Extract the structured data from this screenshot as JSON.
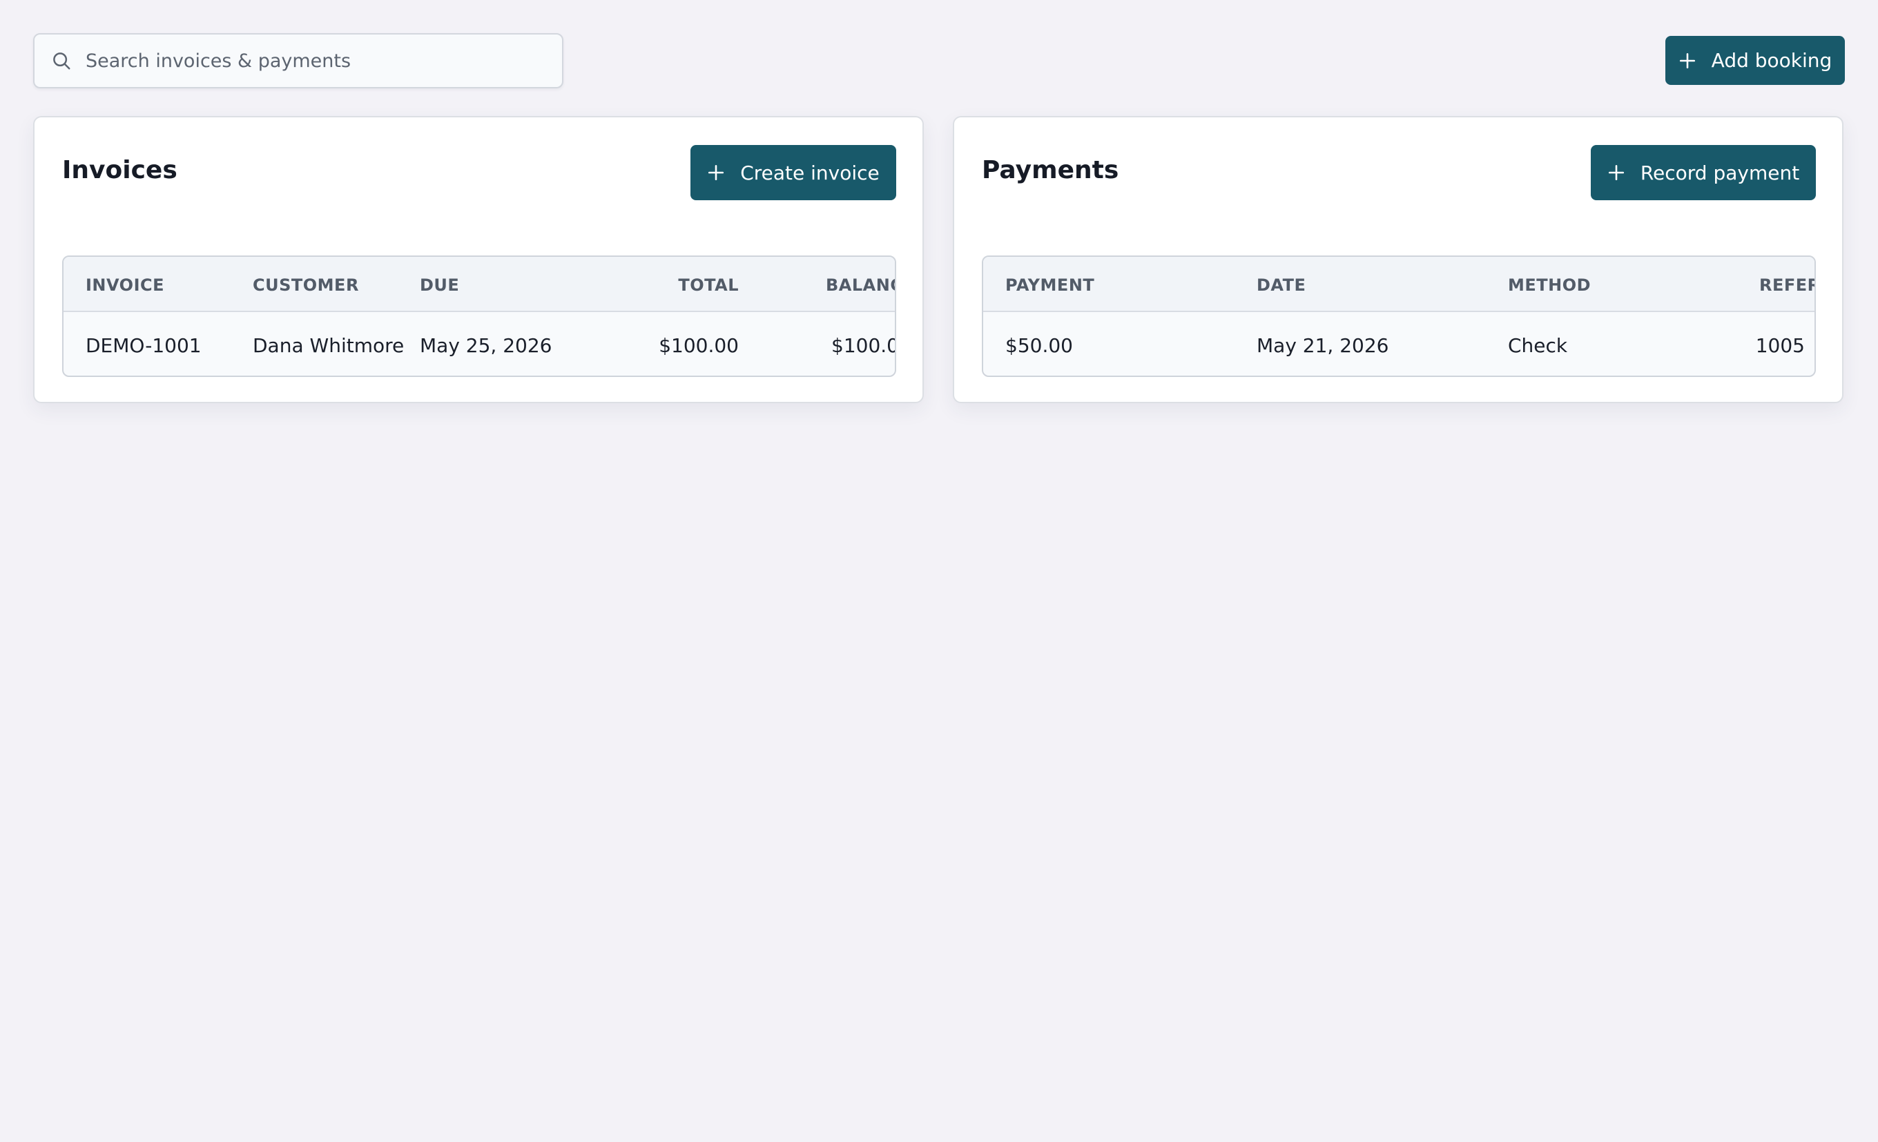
{
  "search": {
    "placeholder": "Search invoices & payments",
    "icon": "search-icon"
  },
  "header": {
    "add_booking_label": "Add booking"
  },
  "invoices": {
    "title": "Invoices",
    "create_label": "Create invoice",
    "columns": [
      "INVOICE",
      "CUSTOMER",
      "DUE",
      "TOTAL",
      "BALANC"
    ],
    "rows": [
      {
        "invoice": "DEMO-1001",
        "customer": "Dana Whitmore",
        "due": "May 25, 2026",
        "total": "$100.00",
        "balance": "$100.0"
      }
    ]
  },
  "payments": {
    "title": "Payments",
    "record_label": "Record payment",
    "columns": [
      "PAYMENT",
      "DATE",
      "METHOD",
      "REFER"
    ],
    "rows": [
      {
        "payment": "$50.00",
        "date": "May 21, 2026",
        "method": "Check",
        "reference": "1005"
      }
    ]
  },
  "colors": {
    "accent": "#18596a",
    "background": "#f3f2f7",
    "card": "#ffffff"
  }
}
